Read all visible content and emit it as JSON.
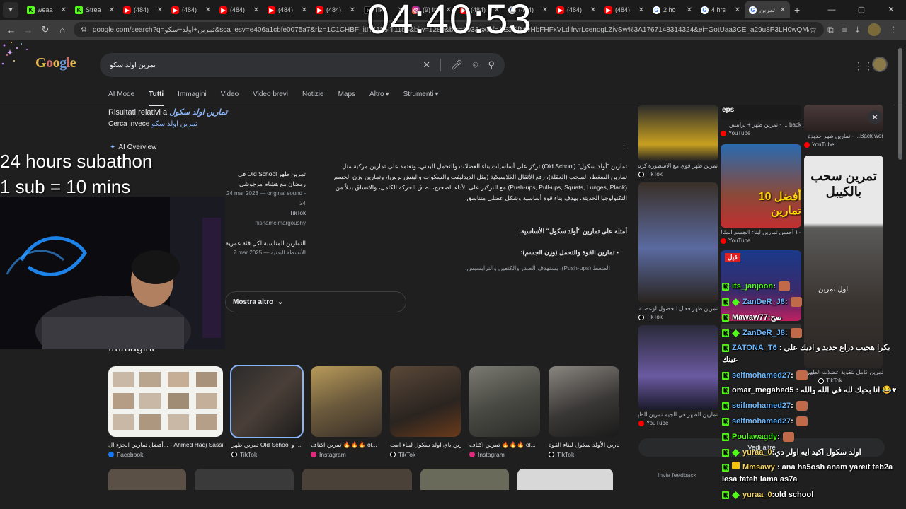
{
  "browser": {
    "tabs": [
      {
        "icon": "kick",
        "title": "weaa"
      },
      {
        "icon": "kick",
        "title": "Strea"
      },
      {
        "icon": "youtube",
        "title": "(484)"
      },
      {
        "icon": "youtube",
        "title": "(484)"
      },
      {
        "icon": "youtube",
        "title": "(484)"
      },
      {
        "icon": "youtube",
        "title": "(484)"
      },
      {
        "icon": "youtube",
        "title": "(484)"
      },
      {
        "icon": "tiktok",
        "title": "TikT"
      },
      {
        "icon": "instagram",
        "title": "(9) In"
      },
      {
        "icon": "youtube",
        "title": "(484)"
      },
      {
        "icon": "google",
        "title": "(484)"
      },
      {
        "icon": "youtube",
        "title": "(484)"
      },
      {
        "icon": "youtube",
        "title": "(484)"
      },
      {
        "icon": "google",
        "title": "2 ho"
      },
      {
        "icon": "google",
        "title": "4 hrs"
      },
      {
        "icon": "google",
        "title": "تمرين"
      }
    ],
    "url": "google.com/search?q=تمرين+اولد+سكو&sca_esv=e406a1cbfe0075a7&rlz=1C1CHBF_itIT1156IT1156&biw=1280&bih=603&sxsrf=AE3TifMlvHbFHFxVLdlfrvrLcenogLZivSw%3A1767148314324&ei=GotUaa3CE_a29u8P3LH0wQM&ved=2ahUKEwitt6m85OaRAxV2m_0..."
  },
  "search": {
    "query": "تمرين اولد سكو",
    "tabs": [
      "AI Mode",
      "Tutti",
      "Immagini",
      "Video",
      "Video brevi",
      "Notizie",
      "Maps",
      "Altro",
      "Strumenti"
    ],
    "active_tab": "Tutti",
    "results_for_prefix": "Risultati relativi a",
    "results_for_query": "تمارين اولد سكول",
    "search_instead_prefix": "Cerca invece",
    "search_instead_query": "تمرين اولد سكو"
  },
  "ai_overview": {
    "label": "AI Overview",
    "paragraph": "تمارين \"أولد سكول\" (Old School) تركز على أساسيات بناء العضلات والتحمل البدني، وتعتمد على تمارين مركبة مثل تمارين الضغط، السحب (العقلة)، رفع الأثقال الكلاسيكية (مثل الديدليفت والسكوات والبنش برس)، وتمارين وزن الجسم (Push-ups, Pull-ups, Squats, Lunges, Plank) مع التركيز على الأداء الصحيح، تطاق الحركة الكامل، والاتساق بدلاً من التكنولوجيا الحديثة، بهدف بناء قوة أساسية وشكل عضلي متناسق.",
    "examples_heading": "أمثلة على تمارين \"أولد سكول\" الأساسية:",
    "bullet_heading": "تمارين القوة والتحمل (وزن الجسم):",
    "bullet_sub": "الضغط (Push-ups): يستهدف الصدر والكتفين والترايسبس.",
    "sources": [
      {
        "title": "تمرين ظهر Old School في رمضان مع هشام مرجوشي",
        "meta": "24 mar 2023 — original sound - 24",
        "platform": "TikTok",
        "handle": "hishamelmargoushy"
      },
      {
        "title": "التمارين المناسبة لكل فئة عمرية",
        "meta": "2 mar 2025 — الأنشطة البدنية",
        "platform": "",
        "handle": ""
      }
    ],
    "show_more": "Mostra altro"
  },
  "images": {
    "heading": "Immagini",
    "items": [
      {
        "caption": "أفضل تمارين الجزء ال... - Ahmed Hadj Sassi",
        "platform": "Facebook"
      },
      {
        "caption": "تمرين ظهر Old School و ...",
        "platform": "TikTok"
      },
      {
        "caption": "تمرين اكتاف 🔥🔥🔥 ol...",
        "platform": "Instagram"
      },
      {
        "caption": "تمرين باي اولد سكول لبناء امت...",
        "platform": "TikTok"
      },
      {
        "caption": "تمرين اكتاف 🔥🔥🔥 ol...",
        "platform": "Instagram"
      },
      {
        "caption": "تمارين الأولد سكول لبناء القوة",
        "platform": "TikTok"
      }
    ]
  },
  "right_panel": {
    "captions": [
      {
        "text": "تمرين ظهر قوي مع الأسطورة كريس",
        "platform": "TikTok"
      },
      {
        "text": "back ... - تمرين ظهر + ترابيس",
        "platform": "YouTube"
      },
      {
        "text": "Back wor... - تمارين ظهر جديدة",
        "platform": "YouTube"
      },
      {
        "text": "١٠ أحسن تمارين لبناء الجسم المثالي",
        "platform": "YouTube"
      },
      {
        "text": "تمرين ظهر فعال للحصول لوعضلة البدنية",
        "platform": "TikTok"
      },
      {
        "text": "تمرين كامل لتقوية عضلات الظهر",
        "platform": "TikTok"
      },
      {
        "text": "تمارين الظهر في الجيم تمرين الظهر",
        "platform": "YouTube"
      }
    ],
    "thumb_texts": {
      "eps": "eps",
      "afdal": "أفضل 10 تمارين",
      "sahb": "تمرين سحب بالكيبل",
      "qabl": "قبل",
      "awal": "اول تمرين"
    },
    "see_all": "Vedi altre",
    "feedback": "Invia feedback"
  },
  "overlay": {
    "timer": "04:40:53",
    "subathon_line1": "24 hours subathon",
    "subathon_line2": "1 sub = 10 mins"
  },
  "chat": [
    {
      "user": "its_janjoon",
      "text": "",
      "color": "#53fc18",
      "badges": [
        "kick"
      ]
    },
    {
      "user": "ZanDeR_J8",
      "text": "",
      "color": "#6bb8ff",
      "badges": [
        "kick",
        "sub"
      ]
    },
    {
      "user": "Mawaw77",
      "text": "صح",
      "color": "#ffffff",
      "badges": [
        "kick"
      ]
    },
    {
      "user": "ZanDeR_J8",
      "text": "",
      "color": "#6bb8ff",
      "badges": [
        "kick",
        "sub"
      ]
    },
    {
      "user": "ZATONA_T6",
      "text": "بكرا هجيب دراع جديد و اديك علي عينك",
      "color": "#6bb8ff",
      "badges": [
        "kick"
      ]
    },
    {
      "user": "seifmohamed27",
      "text": "",
      "color": "#6bb8ff",
      "badges": [
        "kick"
      ]
    },
    {
      "user": "omar_megahed5",
      "text": "انا بحبك لله في الله والله 😂♥",
      "color": "#ffffff",
      "badges": [
        "kick"
      ]
    },
    {
      "user": "seifmohamed27",
      "text": "",
      "color": "#6bb8ff",
      "badges": [
        "kick"
      ]
    },
    {
      "user": "seifmohamed27",
      "text": "",
      "color": "#6bb8ff",
      "badges": [
        "kick"
      ]
    },
    {
      "user": "Poulawagdy",
      "text": "",
      "color": "#53fc18",
      "badges": [
        "kick"
      ]
    },
    {
      "user": "yuraa_0",
      "text": "اولد سكول اكيد ايه اولر دي",
      "color": "#f4d35e",
      "badges": [
        "kick",
        "sub"
      ]
    },
    {
      "user": "Mmsawy",
      "text": "ana ha5osh anam yareit teb2a lesa fateh lama as7a",
      "color": "#f4d35e",
      "badges": [
        "kick",
        "gift"
      ]
    },
    {
      "user": "yuraa_0",
      "text": "old school",
      "color": "#f4d35e",
      "badges": [
        "kick",
        "sub"
      ]
    }
  ]
}
